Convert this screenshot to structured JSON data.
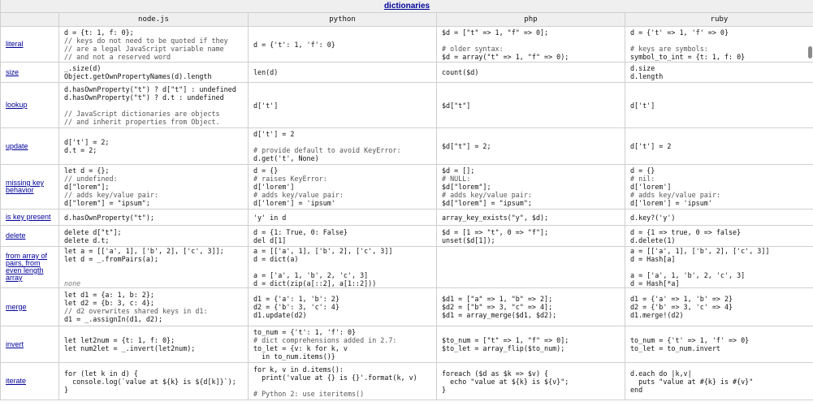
{
  "section": {
    "title": "dictionaries"
  },
  "columns": [
    "node.js",
    "python",
    "php",
    "ruby"
  ],
  "rows": [
    {
      "label": "literal",
      "cells": [
        "d = {t: 1, f: 0};\n// keys do not need to be quoted if they\n// are a legal JavaScript variable name\n// and not a reserved word",
        "d = {'t': 1, 'f': 0}",
        "$d = [\"t\" => 1, \"f\" => 0];\n\n# older syntax:\n$d = array(\"t\" => 1, \"f\" => 0);",
        "d = {'t' => 1, 'f' => 0}\n\n# keys are symbols:\nsymbol_to_int = {t: 1, f: 0}"
      ]
    },
    {
      "label": "size",
      "cells": [
        "_.size(d)\nObject.getOwnPropertyNames(d).length",
        "len(d)",
        "count($d)",
        "d.size\nd.length"
      ]
    },
    {
      "label": "lookup",
      "cells": [
        "d.hasOwnProperty(\"t\") ? d[\"t\"] : undefined\nd.hasOwnProperty(\"t\") ? d.t : undefined\n\n// JavaScript dictionaries are objects\n// and inherit properties from Object.",
        "d['t']",
        "$d[\"t\"]",
        "d['t']"
      ]
    },
    {
      "label": "update",
      "cells": [
        "d['t'] = 2;\nd.t = 2;",
        "d['t'] = 2\n\n# provide default to avoid KeyError:\nd.get('t', None)",
        "$d[\"t\"] = 2;",
        "d['t'] = 2"
      ]
    },
    {
      "label": "missing key behavior",
      "cells": [
        "let d = {};\n// undefined:\nd[\"lorem\"];\n// adds key/value pair:\nd[\"lorem\"] = \"ipsum\";",
        "d = {}\n# raises KeyError:\nd['lorem']\n# adds key/value pair:\nd['lorem'] = 'ipsum'",
        "$d = [];\n# NULL:\n$d[\"lorem\"];\n# adds key/value pair:\n$d[\"lorem\"] = \"ipsum\";",
        "d = {}\n# nil:\nd['lorem']\n# adds key/value pair:\nd['lorem'] = 'ipsum'"
      ]
    },
    {
      "label": "is key present",
      "cells": [
        "d.hasOwnProperty(\"t\");",
        "'y' in d",
        "array_key_exists(\"y\", $d);",
        "d.key?('y')"
      ]
    },
    {
      "label": "delete",
      "cells": [
        "delete d[\"t\"];\ndelete d.t;",
        "d = {1: True, 0: False}\ndel d[1]",
        "$d = [1 => \"t\", 0 => \"f\"];\nunset($d[1]);",
        "d = {1 => true, 0 => false}\nd.delete(1)"
      ]
    },
    {
      "label": "from array of pairs, from even length array",
      "cells": [
        "let a = [['a', 1], ['b', 2], ['c', 3]];\nlet d = _.fromPairs(a);\n\n\nnone",
        "a = [['a', 1], ['b', 2], ['c', 3]]\nd = dict(a)\n\na = ['a', 1, 'b', 2, 'c', 3]\nd = dict(zip(a[::2], a[1::2]))",
        "",
        "a = [['a', 1], ['b', 2], ['c', 3]]\nd = Hash[a]\n\na = ['a', 1, 'b', 2, 'c', 3]\nd = Hash[*a]"
      ]
    },
    {
      "label": "merge",
      "cells": [
        "let d1 = {a: 1, b: 2};\nlet d2 = {b: 3, c: 4};\n// d2 overwrites shared keys in d1:\nd1 = _.assignIn(d1, d2);",
        "d1 = {'a': 1, 'b': 2}\nd2 = {'b': 3, 'c': 4}\nd1.update(d2)",
        "$d1 = [\"a\" => 1, \"b\" => 2];\n$d2 = [\"b\" => 3, \"c\" => 4];\n$d1 = array_merge($d1, $d2);",
        "d1 = {'a' => 1, 'b' => 2}\nd2 = {'b' => 3, 'c' => 4}\nd1.merge!(d2)"
      ]
    },
    {
      "label": "invert",
      "cells": [
        "let let2num = {t: 1, f: 0};\nlet num2let = _.invert(let2num);",
        "to_num = {'t': 1, 'f': 0}\n# dict comprehensions added in 2.7:\nto_let = {v: k for k, v\n  in to_num.items()}",
        "$to_num = [\"t\" => 1, \"f\" => 0];\n$to_let = array_flip($to_num);",
        "to_num = {'t' => 1, 'f' => 0}\nto_let = to_num.invert"
      ]
    },
    {
      "label": "iterate",
      "cells": [
        "for (let k in d) {\n  console.log(`value at ${k} is ${d[k]}`);\n}",
        "for k, v in d.items():\n  print('value at {} is {}'.format(k, v)\n\n# Python 2: use iteritems()",
        "foreach ($d as $k => $v) {\n  echo \"value at ${k} is ${v}\";\n}",
        "d.each do |k,v|\n  puts \"value at #{k} is #{v}\"\nend"
      ]
    }
  ]
}
